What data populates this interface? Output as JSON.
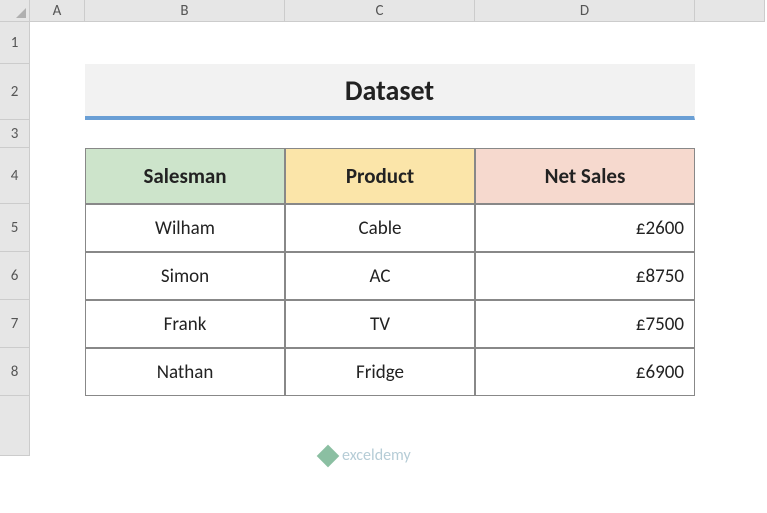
{
  "columns": [
    "A",
    "B",
    "C",
    "D",
    ""
  ],
  "rows": [
    "1",
    "2",
    "3",
    "4",
    "5",
    "6",
    "7",
    "8",
    ""
  ],
  "title": "Dataset",
  "headers": {
    "salesman": "Salesman",
    "product": "Product",
    "net_sales": "Net Sales"
  },
  "data": [
    {
      "salesman": "Wilham",
      "product": "Cable",
      "net_sales": "£2600"
    },
    {
      "salesman": "Simon",
      "product": "AC",
      "net_sales": "£8750"
    },
    {
      "salesman": "Frank",
      "product": "TV",
      "net_sales": "£7500"
    },
    {
      "salesman": "Nathan",
      "product": "Fridge",
      "net_sales": "£6900"
    }
  ],
  "watermark": "exceldemy"
}
